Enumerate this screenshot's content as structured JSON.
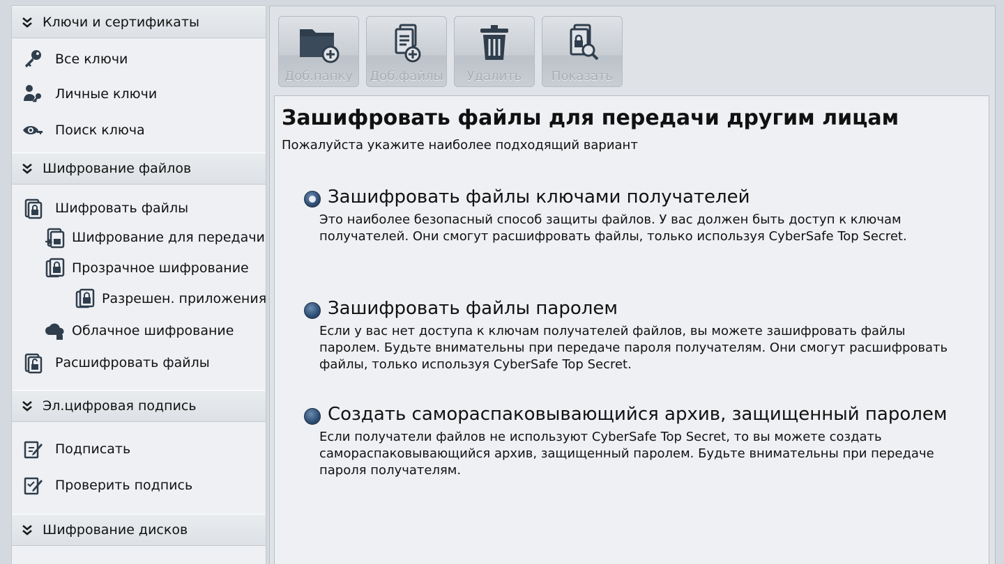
{
  "sidebar": {
    "sections": [
      {
        "label": "Ключи и сертификаты"
      },
      {
        "label": "Шифрование файлов"
      },
      {
        "label": "Эл.цифровая подпись"
      },
      {
        "label": "Шифрование дисков"
      }
    ],
    "items": {
      "all_keys": "Все ключи",
      "personal_keys": "Личные ключи",
      "key_search": "Поиск ключа",
      "encrypt_files": "Шифровать файлы",
      "encrypt_transfer": "Шифрование для передачи",
      "transparent_encryption": "Прозрачное шифрование",
      "allowed_apps": "Разрешен. приложения",
      "cloud_encryption": "Облачное шифрование",
      "decrypt_files": "Расшифровать файлы",
      "sign": "Подписать",
      "verify_signature": "Проверить подпись"
    }
  },
  "toolbar": {
    "add_folder": "Доб.папку",
    "add_files": "Доб.файлы",
    "delete": "Удалить",
    "show": "Показать"
  },
  "main": {
    "title": "Зашифровать файлы для передачи другим лицам",
    "subtitle": "Пожалуйста укажите наиболее подходящий вариант",
    "options": [
      {
        "label": "Зашифровать файлы ключами получателей",
        "description": "Это наиболее безопасный способ защиты файлов. У вас должен быть доступ к ключам получателей. Они смогут расшифровать файлы, только используя CyberSafe Top Secret.",
        "selected": true
      },
      {
        "label": "Зашифровать файлы паролем",
        "description": "Если у вас нет доступа к ключам получателей файлов, вы можете зашифровать файлы паролем. Будьте внимательны при передаче пароля получателям. Они смогут расшифровать файлы, только используя CyberSafe Top Secret.",
        "selected": false
      },
      {
        "label": "Создать самораспаковывающийся архив, защищенный паролем",
        "description": "Если получатели файлов не используют CyberSafe Top Secret, то вы можете создать самораспаковывающийся архив, защищенный паролем. Будьте внимательны при передаче пароля получателям.",
        "selected": false
      }
    ]
  },
  "colors": {
    "icon_dark": "#2f3d4c",
    "disabled_text": "#a9aeb4",
    "radio_blue": "#2e4d72"
  }
}
